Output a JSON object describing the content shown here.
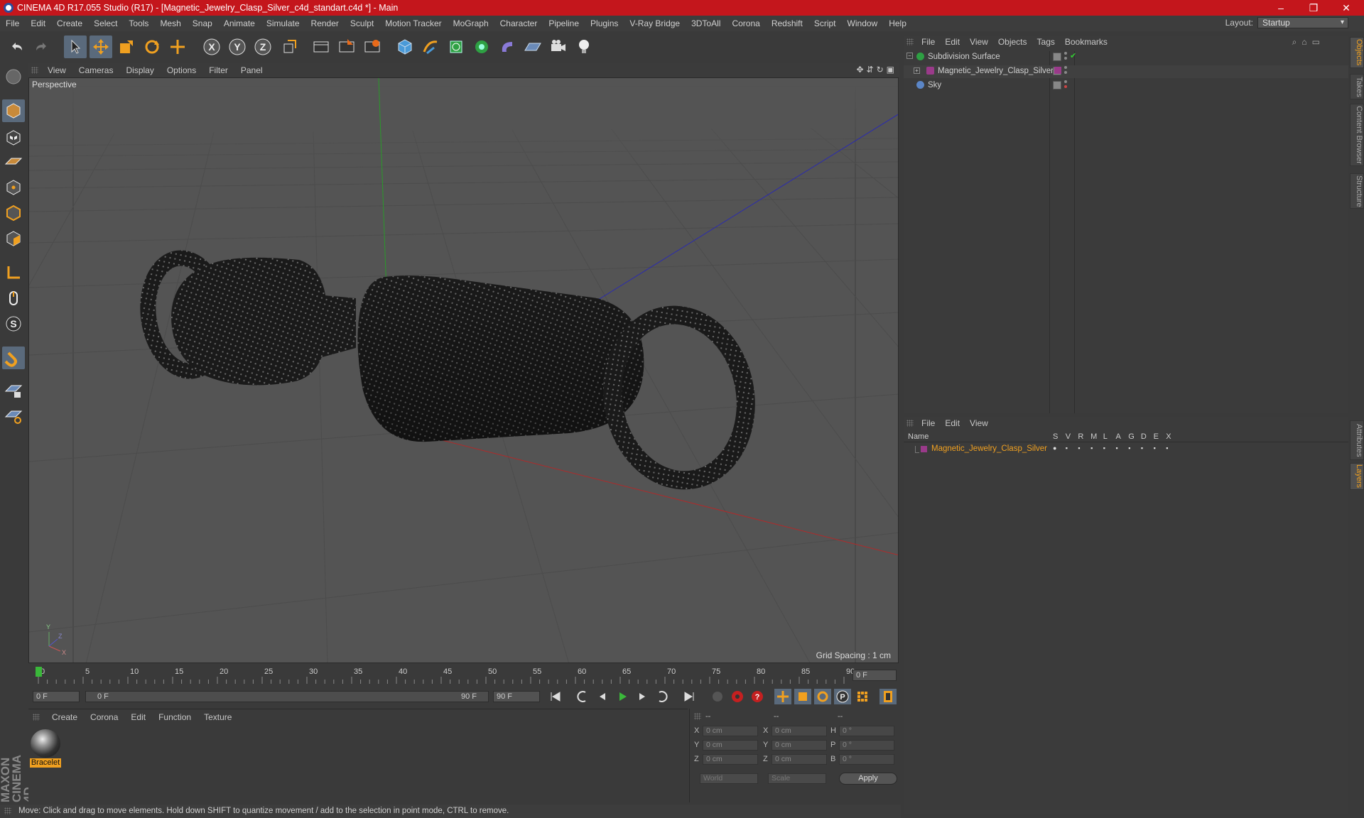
{
  "window": {
    "title": "CINEMA 4D R17.055 Studio (R17) - [Magnetic_Jewelry_Clasp_Silver_c4d_standart.c4d *] - Main",
    "controls": [
      "–",
      "❐",
      "✕"
    ]
  },
  "menubar": [
    "File",
    "Edit",
    "Create",
    "Select",
    "Tools",
    "Mesh",
    "Snap",
    "Animate",
    "Simulate",
    "Render",
    "Sculpt",
    "Motion Tracker",
    "MoGraph",
    "Character",
    "Pipeline",
    "Plugins",
    "V-Ray Bridge",
    "3DToAll",
    "Corona",
    "Redshift",
    "Script",
    "Window",
    "Help"
  ],
  "layout": {
    "label": "Layout:",
    "value": "Startup"
  },
  "viewport": {
    "menu": [
      "View",
      "Cameras",
      "Display",
      "Options",
      "Filter",
      "Panel"
    ],
    "label": "Perspective",
    "grid_spacing": "Grid Spacing : 1 cm"
  },
  "timeline": {
    "ticks": [
      "0",
      "5",
      "10",
      "15",
      "20",
      "25",
      "30",
      "35",
      "40",
      "45",
      "50",
      "55",
      "60",
      "65",
      "70",
      "75",
      "80",
      "85",
      "90"
    ],
    "current_frame": "0 F"
  },
  "transport": {
    "start": "0 F",
    "range_start": "0 F",
    "range_end": "90 F",
    "end": "90 F"
  },
  "material_manager": {
    "menu": [
      "Create",
      "Corona",
      "Edit",
      "Function",
      "Texture"
    ],
    "materials": [
      {
        "name": "Bracelet"
      }
    ]
  },
  "coordinates": {
    "headers": [
      "--",
      "--",
      "--"
    ],
    "rows": [
      {
        "a": "X",
        "av": "0 cm",
        "b": "X",
        "bv": "0 cm",
        "c": "H",
        "cv": "0 °"
      },
      {
        "a": "Y",
        "av": "0 cm",
        "b": "Y",
        "bv": "0 cm",
        "c": "P",
        "cv": "0 °"
      },
      {
        "a": "Z",
        "av": "0 cm",
        "b": "Z",
        "bv": "0 cm",
        "c": "B",
        "cv": "0 °"
      }
    ],
    "mode": "World",
    "size_mode": "Scale",
    "apply": "Apply"
  },
  "object_manager": {
    "menu": [
      "File",
      "Edit",
      "View",
      "Objects",
      "Tags",
      "Bookmarks"
    ],
    "objects": [
      {
        "name": "Subdivision Surface",
        "color": "#2ea043"
      },
      {
        "name": "Magnetic_Jewelry_Clasp_Silver",
        "color": "#9a3a8a"
      },
      {
        "name": "Sky",
        "color": "#5b86c7"
      }
    ]
  },
  "layer_manager": {
    "menu": [
      "File",
      "Edit",
      "View"
    ],
    "columns": [
      "Name",
      "S",
      "V",
      "R",
      "M",
      "L",
      "A",
      "G",
      "D",
      "E",
      "X"
    ],
    "layers": [
      {
        "name": "Magnetic_Jewelry_Clasp_Silver",
        "color": "#9a3a8a"
      }
    ]
  },
  "right_tabs": [
    "Objects",
    "Takes",
    "Content Browser",
    "Structure",
    "Attributes",
    "Layers"
  ],
  "status": "Move: Click and drag to move elements. Hold down SHIFT to quantize movement / add to the selection in point mode, CTRL to remove.",
  "maxon_logo": "MAXON CINEMA 4D",
  "colors": {
    "titlebar": "#c4161c",
    "accent": "#f0a020",
    "active_tool": "#5a6a7c"
  }
}
